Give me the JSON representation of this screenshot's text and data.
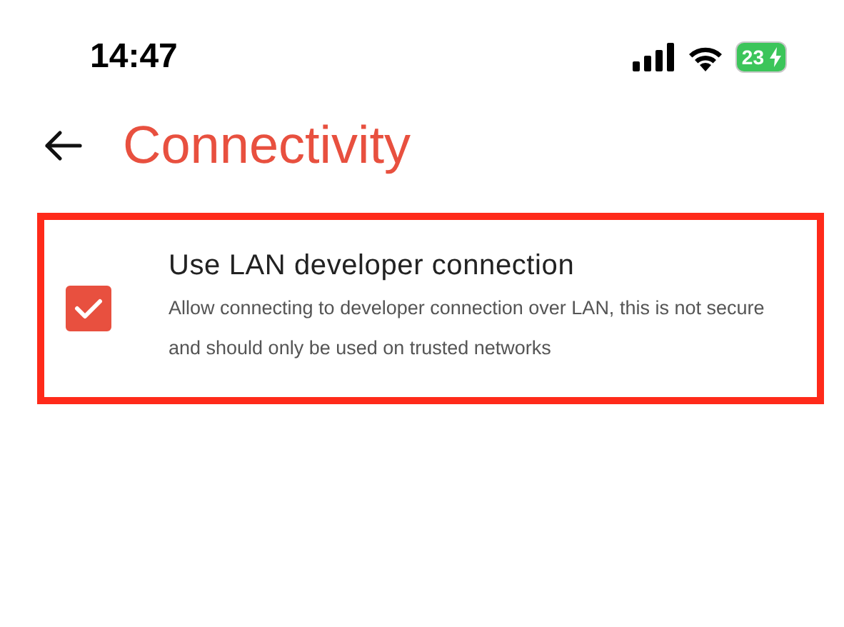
{
  "status_bar": {
    "time": "14:47",
    "battery": "23",
    "charging": true
  },
  "header": {
    "title": "Connectivity"
  },
  "settings": [
    {
      "kind": "checkbox",
      "title": "Use LAN developer connection",
      "description": "Allow connecting to developer connection over LAN, this is not secure and should only be used on trusted networks",
      "checked": true,
      "highlighted": true
    }
  ]
}
